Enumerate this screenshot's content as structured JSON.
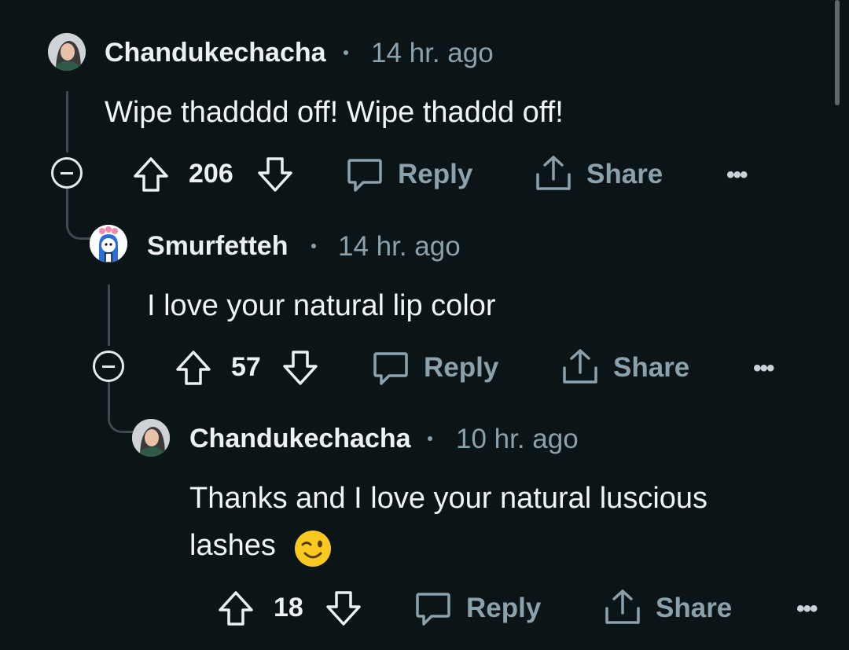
{
  "comments": [
    {
      "username": "Chandukechacha",
      "time": "14 hr. ago",
      "body": "Wipe thadddd off! Wipe thaddd off!",
      "score": "206",
      "reply_label": "Reply",
      "share_label": "Share",
      "more_label": "•••",
      "avatar_icon": "avatar-woman-icon"
    },
    {
      "username": "Smurfetteh",
      "time": "14 hr. ago",
      "body": "I love your natural lip color",
      "score": "57",
      "reply_label": "Reply",
      "share_label": "Share",
      "more_label": "•••",
      "avatar_icon": "avatar-snoo-icon"
    },
    {
      "username": "Chandukechacha",
      "time": "10 hr. ago",
      "body_line1": "Thanks and I love your natural luscious",
      "body_line2": "lashes",
      "body_emoji": "winking-face-emoji",
      "score": "18",
      "reply_label": "Reply",
      "share_label": "Share",
      "more_label": "•••",
      "avatar_icon": "avatar-woman-icon"
    }
  ],
  "colors": {
    "background": "#0b1416",
    "text": "#eef1f3",
    "muted": "#8ba2ad",
    "thread_line": "#3e4a4f"
  }
}
